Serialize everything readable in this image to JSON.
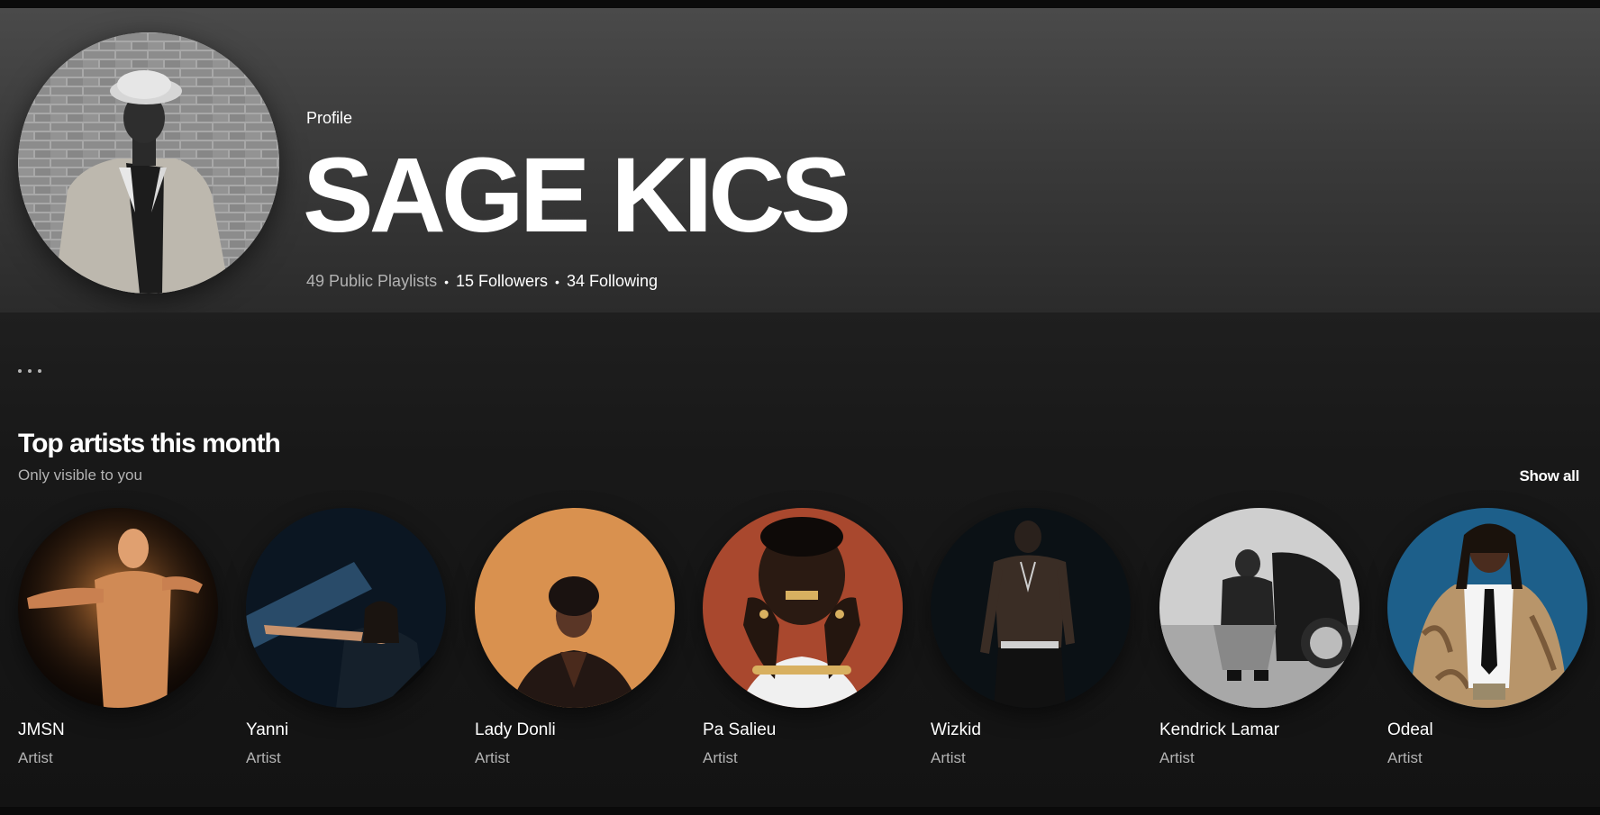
{
  "header": {
    "label": "Profile",
    "name": "SAGE KICS",
    "stats": {
      "playlists": "49 Public Playlists",
      "followers": "15 Followers",
      "following": "34 Following",
      "separator": "•"
    }
  },
  "top_artists": {
    "title": "Top artists this month",
    "subtitle": "Only visible to you",
    "show_all_label": "Show all",
    "items": [
      {
        "name": "JMSN",
        "type": "Artist"
      },
      {
        "name": "Yanni",
        "type": "Artist"
      },
      {
        "name": "Lady Donli",
        "type": "Artist"
      },
      {
        "name": "Pa Salieu",
        "type": "Artist"
      },
      {
        "name": "Wizkid",
        "type": "Artist"
      },
      {
        "name": "Kendrick Lamar",
        "type": "Artist"
      },
      {
        "name": "Odeal",
        "type": "Artist"
      }
    ]
  },
  "colors": {
    "background": "#121212",
    "header_gradient_top": "#4a4a4a",
    "text_primary": "#ffffff",
    "text_secondary": "#b3b3b3"
  },
  "icons": {
    "more": "more-horizontal-icon"
  }
}
